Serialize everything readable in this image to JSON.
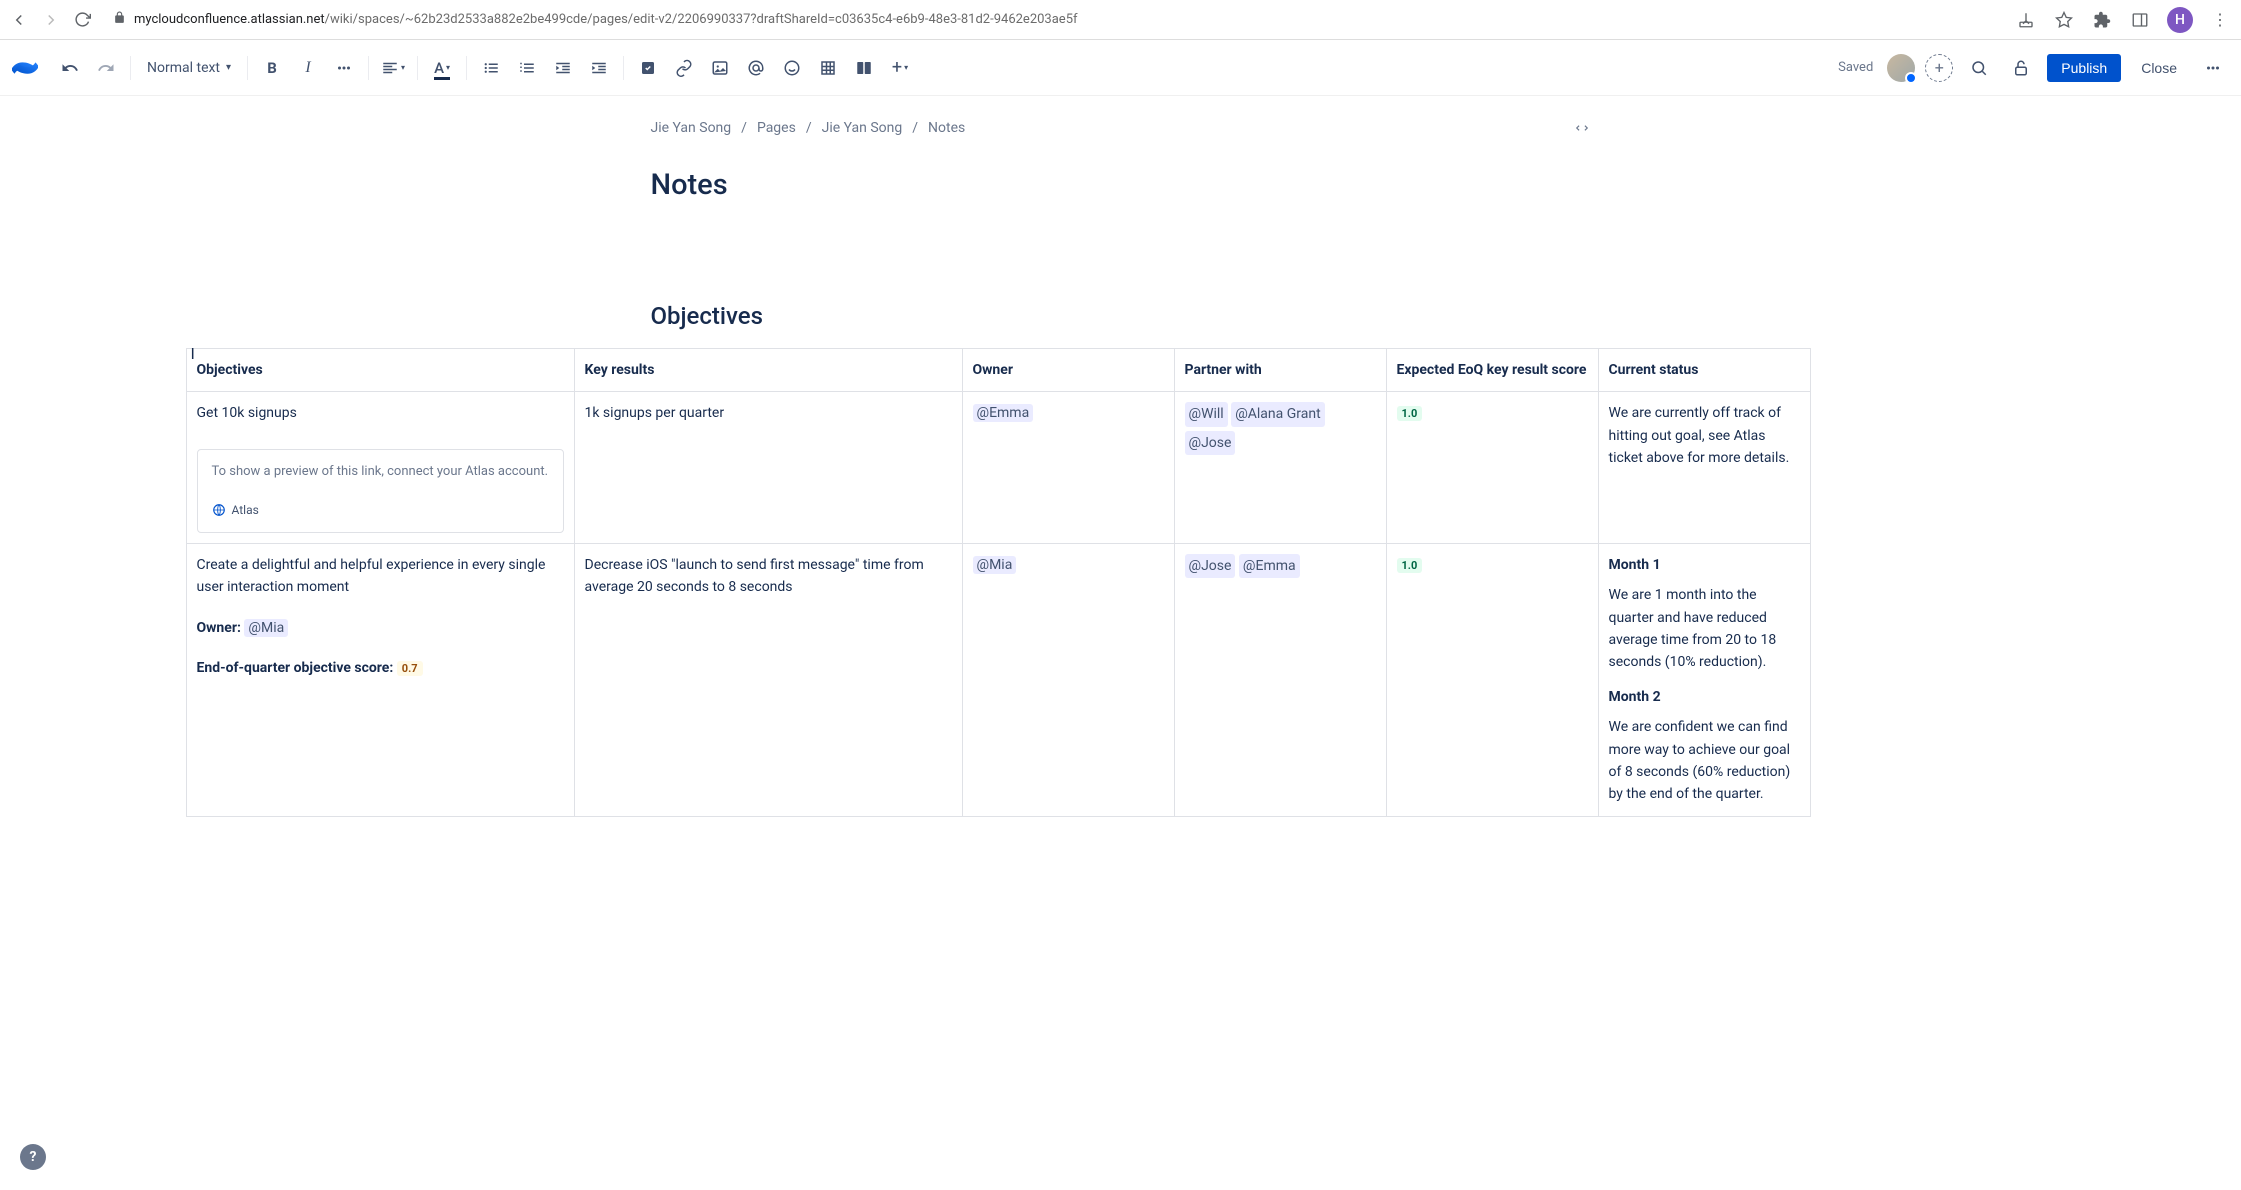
{
  "browser": {
    "url_host": "mycloudconfluence.atlassian.net",
    "url_path": "/wiki/spaces/~62b23d2533a882e2be499cde/pages/edit-v2/2206990337?draftShareId=c03635c4-e6b9-48e3-81d2-9462e203ae5f",
    "avatar_initial": "H"
  },
  "toolbar": {
    "text_style": "Normal text",
    "saved": "Saved",
    "publish": "Publish",
    "close": "Close"
  },
  "breadcrumbs": {
    "items": [
      "Jie Yan Song",
      "Pages",
      "Jie Yan Song",
      "Notes"
    ]
  },
  "page": {
    "title": "Notes",
    "section_heading": "Objectives"
  },
  "table": {
    "headers": {
      "objectives": "Objectives",
      "key_results": "Key results",
      "owner": "Owner",
      "partner": "Partner with",
      "score": "Expected EoQ key result score",
      "status": "Current status"
    },
    "rows": [
      {
        "objective": "Get 10k signups",
        "atlas_hint": "To show a preview of this link, connect your Atlas account.",
        "atlas_label": "Atlas",
        "key_result": "1k signups per quarter",
        "owner_mentions": [
          "@Emma"
        ],
        "partner_mentions": [
          "@Will",
          "@Alana Grant",
          "@Jose"
        ],
        "score": "1.0",
        "status_plain": "We are currently off track of hitting out goal, see Atlas ticket above for more details."
      },
      {
        "objective": "Create a delightful and helpful experience in every single user interaction moment",
        "objective_owner_label": "Owner:",
        "objective_owner_mention": "@Mia",
        "objective_score_label": "End-of-quarter objective score:",
        "objective_score_value": "0.7",
        "key_result": "Decrease iOS \"launch to send first message\" time from average 20 seconds to 8 seconds",
        "owner_mentions": [
          "@Mia"
        ],
        "partner_mentions": [
          "@Jose",
          "@Emma"
        ],
        "score": "1.0",
        "status_months": [
          {
            "label": "Month 1",
            "text": "We are 1 month into the quarter and have reduced average time from 20 to 18 seconds (10% reduction)."
          },
          {
            "label": "Month 2",
            "text": "We are confident we can find more way to achieve our goal of 8 seconds (60% reduction) by the end of the quarter."
          }
        ]
      }
    ]
  }
}
